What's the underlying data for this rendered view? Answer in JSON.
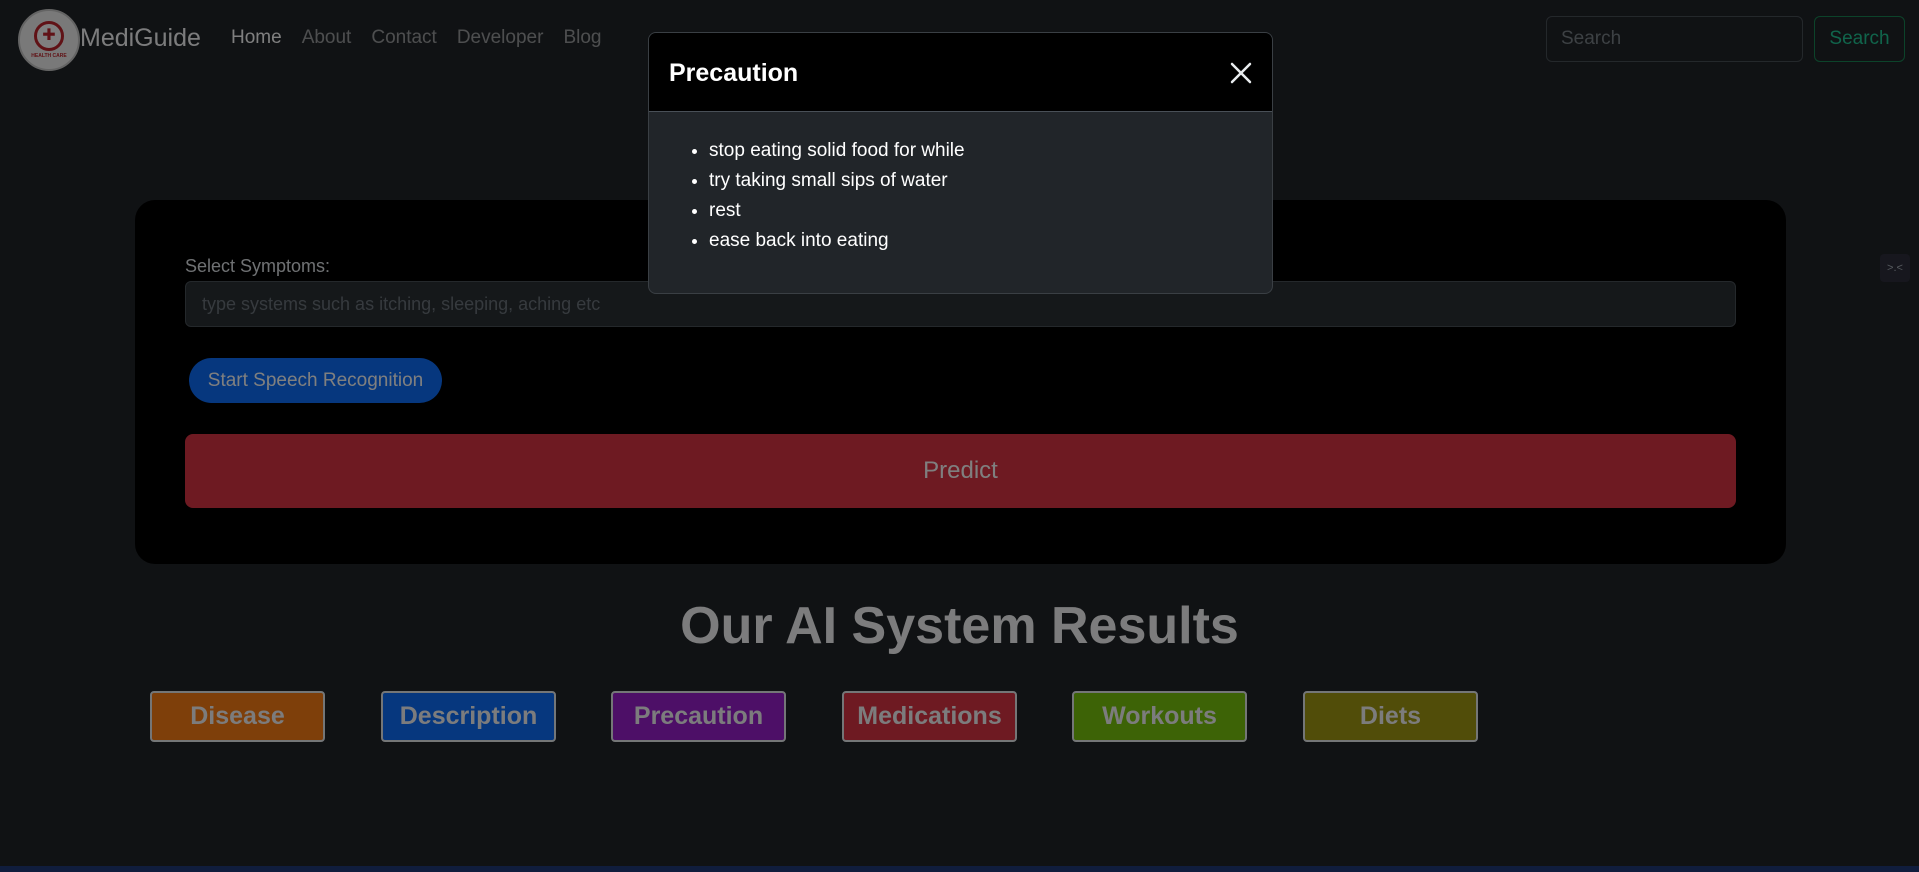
{
  "navbar": {
    "brand": "MediGuide",
    "logo_text": "HEALTH CARE",
    "links": [
      {
        "label": "Home",
        "active": true
      },
      {
        "label": "About",
        "active": false
      },
      {
        "label": "Contact",
        "active": false
      },
      {
        "label": "Developer",
        "active": false
      },
      {
        "label": "Blog",
        "active": false
      }
    ],
    "search": {
      "placeholder": "Search",
      "button_label": "Search"
    }
  },
  "form": {
    "symptoms_label": "Select Symptoms:",
    "symptoms_placeholder": "type systems such as itching, sleeping, aching etc",
    "speech_button": "Start Speech Recognition",
    "predict_button": "Predict"
  },
  "results": {
    "title": "Our AI System Results",
    "buttons": [
      {
        "label": "Disease",
        "color": "#fd7e14"
      },
      {
        "label": "Description",
        "color": "#0d6efd"
      },
      {
        "label": "Precaution",
        "color": "#9b1fcf"
      },
      {
        "label": "Medications",
        "color": "#dc3545"
      },
      {
        "label": "Workouts",
        "color": "#7ac70c"
      },
      {
        "label": "Diets",
        "color": "#a39a12"
      }
    ]
  },
  "modal": {
    "title": "Precaution",
    "items": [
      "stop eating solid food for while",
      "try taking small sips of water",
      "rest",
      "ease back into eating"
    ]
  },
  "side_tab": {
    "label": ">.<"
  },
  "colors": {
    "background": "#212529",
    "card": "#000000",
    "primary": "#0d6efd",
    "danger": "#dc3545",
    "success": "#198754"
  }
}
